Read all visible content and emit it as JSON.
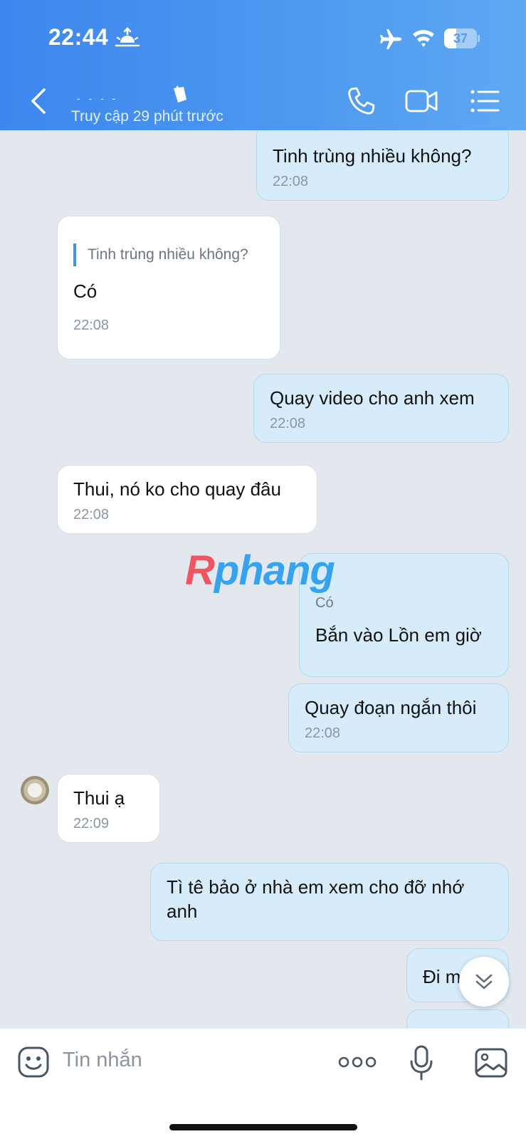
{
  "status_bar": {
    "time": "22:44",
    "battery_level": "37",
    "battery_fraction": 0.37,
    "icons": [
      "sunrise-icon",
      "airplane-icon",
      "wifi-icon",
      "battery-icon"
    ]
  },
  "header": {
    "contact_name_masked": "- - - -",
    "presence": "Truy cập 29 phút trước",
    "icons": [
      "back-icon",
      "phone-icon",
      "video-icon",
      "list-icon"
    ],
    "colors": {
      "gradient_start": "#3d86ee",
      "gradient_end": "#5fa8f3"
    }
  },
  "messages": [
    {
      "direction": "out",
      "text": "Tinh trùng nhiều không?",
      "time": "22:08"
    },
    {
      "direction": "in",
      "quote": "Tinh trùng nhiều không?",
      "text": "Có",
      "time": "22:08"
    },
    {
      "direction": "out",
      "text": "Quay video cho anh xem",
      "time": "22:08"
    },
    {
      "direction": "in",
      "text": "Thui, nó ko cho quay đâu",
      "time": "22:08"
    },
    {
      "direction": "out",
      "quote": "Có",
      "text": "Bắn vào Lồn em giờ"
    },
    {
      "direction": "out",
      "text": "Quay đoạn ngắn thôi",
      "time": "22:08"
    },
    {
      "direction": "in",
      "text": "Thui ạ",
      "time": "22:09"
    },
    {
      "direction": "out",
      "text": "Tì tê bảo ở nhà em xem cho đỡ nhớ anh"
    },
    {
      "direction": "out",
      "text": "Đi m"
    }
  ],
  "watermark": {
    "first": "R",
    "rest": "phang"
  },
  "composer": {
    "placeholder": "Tin nhắn",
    "icons": [
      "emoji-icon",
      "more-icon",
      "microphone-icon",
      "image-icon"
    ]
  },
  "accent_colors": {
    "outgoing_bubble": "#d6ecfb",
    "incoming_bubble": "#ffffff",
    "chat_background": "#e3e8ef",
    "quote_bar": "#4a8fe4"
  }
}
